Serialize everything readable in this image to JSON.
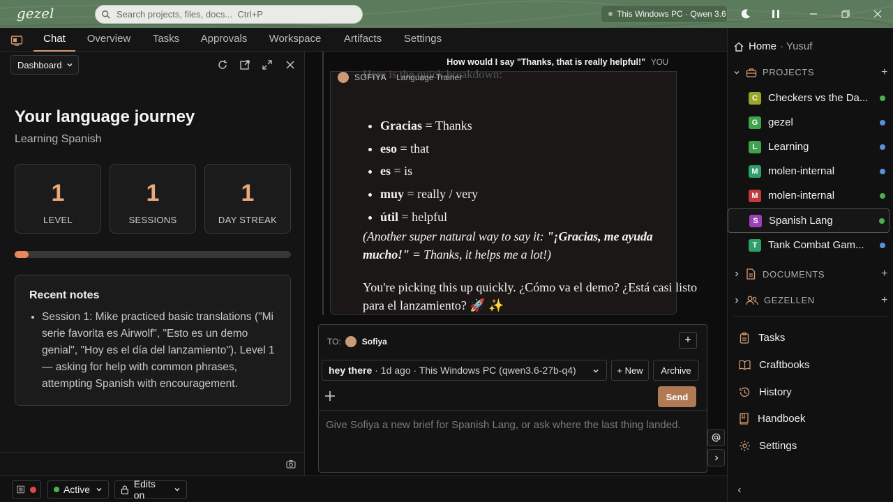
{
  "app": {
    "logo": "gezel"
  },
  "search": {
    "placeholder": "Search projects, files, docs...  Ctrl+P"
  },
  "machine": {
    "label": "This Windows PC · Qwen 3.6"
  },
  "tabs": [
    {
      "label": "Chat",
      "active": true
    },
    {
      "label": "Overview"
    },
    {
      "label": "Tasks"
    },
    {
      "label": "Approvals"
    },
    {
      "label": "Workspace"
    },
    {
      "label": "Artifacts"
    },
    {
      "label": "Settings"
    }
  ],
  "dashboard": {
    "selector": "Dashboard",
    "title": "Your language journey",
    "subtitle": "Learning Spanish",
    "stats": [
      {
        "value": "1",
        "label": "LEVEL"
      },
      {
        "value": "1",
        "label": "SESSIONS"
      },
      {
        "value": "1",
        "label": "DAY STREAK"
      }
    ],
    "progress_fraction": 0.05,
    "notes_title": "Recent notes",
    "notes": [
      "Session 1: Mike practiced basic translations (\"Mi serie favorita es Airwolf\", \"Esto es un demo genial\", \"Hoy es el día del lanzamiento\"). Level 1 — asking for help with common phrases, attempting Spanish with encouragement."
    ]
  },
  "chat": {
    "user_message": "How would I say \"Thanks, that is really helpful!\"",
    "user_tag": "YOU",
    "agent_name": "SOFIYA",
    "agent_role": "Language Trainer",
    "faded_intro": "Here is the quick breakdown:",
    "breakdown": [
      {
        "term": "Gracias",
        "meaning": " = Thanks"
      },
      {
        "term": "eso",
        "meaning": " = that"
      },
      {
        "term": "es",
        "meaning": " = is"
      },
      {
        "term": "muy",
        "meaning": " = really / very"
      },
      {
        "term": "útil",
        "meaning": " = helpful"
      }
    ],
    "alt_intro": "(Another super natural way to say it: ",
    "alt_phrase": "\"¡Gracias, me ayuda mucho!\"",
    "alt_outro": " = Thanks, it helps me a lot!)",
    "closing": "You're picking this up quickly. ¿Cómo va el demo? ¿Está casi listo para el lanzamiento? 🚀 ✨"
  },
  "composer": {
    "to_label": "TO:",
    "to_name": "Sofiya",
    "thread_title": "hey there",
    "thread_meta": "· 1d ago · This Windows PC (qwen3.6-27b-q4)",
    "new_label": "+ New",
    "archive_label": "Archive",
    "send_label": "Send",
    "placeholder": "Give Sofiya a new brief for Spanish Lang, or ask where the last thing landed."
  },
  "sidebar": {
    "home": "Home",
    "user": "· Yusuf",
    "projects_label": "PROJECTS",
    "projects": [
      {
        "initial": "C",
        "name": "Checkers vs the Da...",
        "color": "#9aa52a",
        "dot": "#4caf50"
      },
      {
        "initial": "G",
        "name": "gezel",
        "color": "#3fa34d",
        "dot": "#5b8fe0"
      },
      {
        "initial": "L",
        "name": "Learning",
        "color": "#3fa34d",
        "dot": "#5b8fe0"
      },
      {
        "initial": "M",
        "name": "molen-internal",
        "color": "#2f9e6a",
        "dot": "#5b8fe0"
      },
      {
        "initial": "M",
        "name": "molen-internal",
        "color": "#c23b3b",
        "dot": "#4caf50"
      },
      {
        "initial": "S",
        "name": "Spanish Lang",
        "color": "#9c3fb8",
        "dot": "#4caf50",
        "selected": true
      },
      {
        "initial": "T",
        "name": "Tank Combat Gam...",
        "color": "#2f9e6a",
        "dot": "#5b8fe0"
      }
    ],
    "documents_label": "DOCUMENTS",
    "gezellen_label": "GEZELLEN",
    "nav": [
      {
        "label": "Tasks",
        "icon": "clipboard-icon"
      },
      {
        "label": "Craftbooks",
        "icon": "book-open-icon"
      },
      {
        "label": "History",
        "icon": "history-icon"
      },
      {
        "label": "Handboek",
        "icon": "book-icon"
      },
      {
        "label": "Settings",
        "icon": "gear-icon"
      }
    ]
  },
  "bottom": {
    "status": "Active",
    "edits": "Edits on"
  },
  "colors": {
    "accent": "#d59b70",
    "send": "#b07a55",
    "stat_number": "#e9a97a",
    "titlebar": "#5c7a5c"
  }
}
